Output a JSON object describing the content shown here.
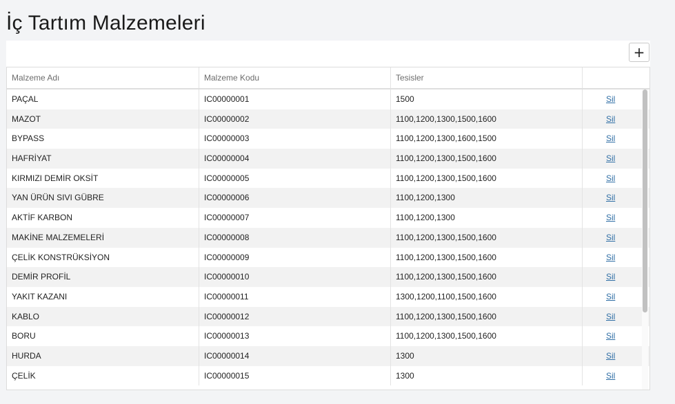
{
  "page": {
    "title": "İç Tartım Malzemeleri"
  },
  "toolbar": {
    "add_label": "+"
  },
  "table": {
    "columns": [
      "Malzeme Adı",
      "Malzeme Kodu",
      "Tesisler",
      ""
    ],
    "action_label": "Sil",
    "rows": [
      {
        "name": "PAÇAL",
        "code": "IC00000001",
        "plants": "1500"
      },
      {
        "name": "MAZOT",
        "code": "IC00000002",
        "plants": "1100,1200,1300,1500,1600"
      },
      {
        "name": "BYPASS",
        "code": "IC00000003",
        "plants": "1100,1200,1300,1600,1500"
      },
      {
        "name": "HAFRİYAT",
        "code": "IC00000004",
        "plants": "1100,1200,1300,1500,1600"
      },
      {
        "name": "KIRMIZI DEMİR OKSİT",
        "code": "IC00000005",
        "plants": "1100,1200,1300,1500,1600"
      },
      {
        "name": "YAN ÜRÜN SIVI GÜBRE",
        "code": "IC00000006",
        "plants": "1100,1200,1300"
      },
      {
        "name": "AKTİF KARBON",
        "code": "IC00000007",
        "plants": "1100,1200,1300"
      },
      {
        "name": "MAKİNE MALZEMELERİ",
        "code": "IC00000008",
        "plants": "1100,1200,1300,1500,1600"
      },
      {
        "name": "ÇELİK KONSTRÜKSİYON",
        "code": "IC00000009",
        "plants": "1100,1200,1300,1500,1600"
      },
      {
        "name": "DEMİR PROFİL",
        "code": "IC00000010",
        "plants": "1100,1200,1300,1500,1600"
      },
      {
        "name": "YAKIT KAZANI",
        "code": "IC00000011",
        "plants": "1300,1200,1100,1500,1600"
      },
      {
        "name": "KABLO",
        "code": "IC00000012",
        "plants": "1100,1200,1300,1500,1600"
      },
      {
        "name": "BORU",
        "code": "IC00000013",
        "plants": "1100,1200,1300,1500,1600"
      },
      {
        "name": "HURDA",
        "code": "IC00000014",
        "plants": "1300"
      },
      {
        "name": "ÇELİK",
        "code": "IC00000015",
        "plants": "1300"
      }
    ]
  }
}
